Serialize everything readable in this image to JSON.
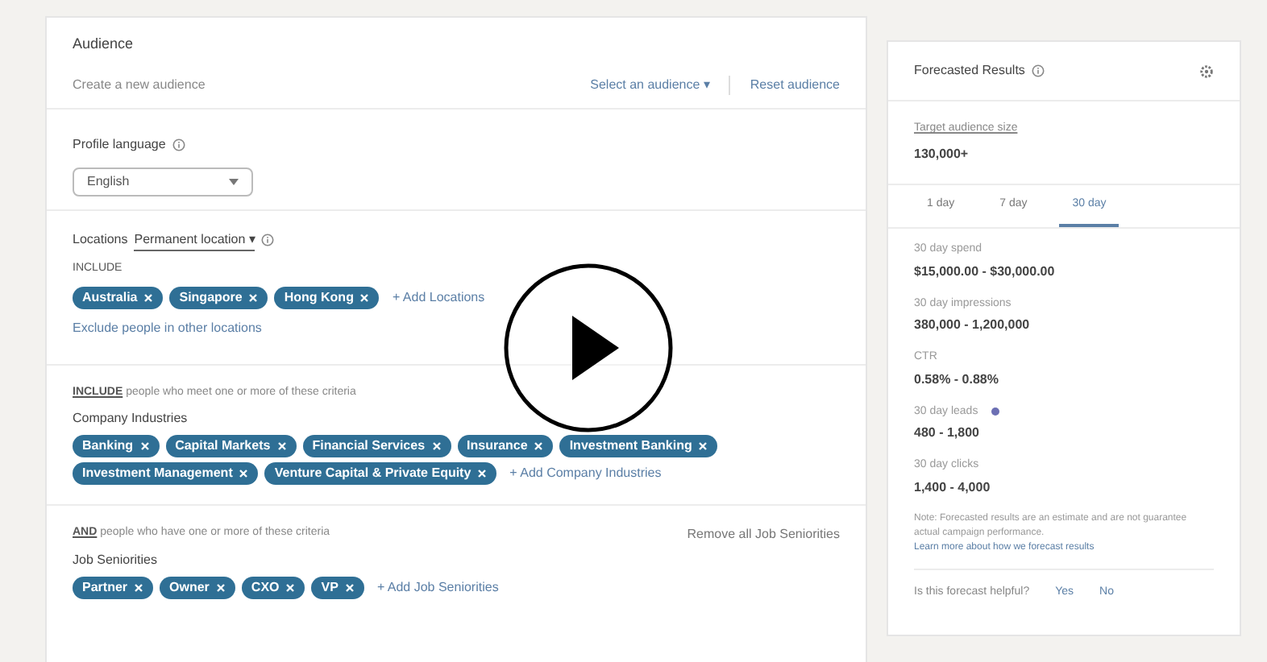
{
  "audience": {
    "title": "Audience",
    "subtitle": "Create a new audience",
    "select_link": "Select an audience ▾",
    "reset_link": "Reset audience"
  },
  "profile_language": {
    "label": "Profile language",
    "value": "English"
  },
  "locations": {
    "label": "Locations",
    "type_select": "Permanent location ▾",
    "include_label": "INCLUDE",
    "chips": [
      "Australia",
      "Singapore",
      "Hong Kong"
    ],
    "add_link": "+ Add Locations",
    "exclude_link": "Exclude people in other locations"
  },
  "criteria": [
    {
      "lead": "INCLUDE",
      "text": "people who meet one or more of these criteria",
      "label": "Company Industries",
      "chips": [
        "Banking",
        "Capital Markets",
        "Financial Services",
        "Insurance",
        "Investment Banking",
        "Investment Management",
        "Venture Capital & Private Equity"
      ],
      "add_link": "+ Add Company Industries"
    },
    {
      "lead": "AND",
      "text": "people who have one or more of these criteria",
      "remove_link": "Remove all Job Seniorities",
      "label": "Job Seniorities",
      "chips": [
        "Partner",
        "Owner",
        "CXO",
        "VP"
      ],
      "add_link": "+ Add Job Seniorities"
    }
  ],
  "forecast": {
    "title": "Forecasted Results",
    "target_label": "Target audience size",
    "target_value": "130,000+",
    "tabs": [
      {
        "label": "1 day",
        "selected": false
      },
      {
        "label": "7 day",
        "selected": false
      },
      {
        "label": "30 day",
        "selected": true
      }
    ],
    "metrics": [
      {
        "label": "30 day spend",
        "value": "$15,000.00 - $30,000.00",
        "flag": false
      },
      {
        "label": "30 day impressions",
        "value": "380,000 - 1,200,000",
        "flag": false
      },
      {
        "label": "CTR",
        "value": "0.58% - 0.88%",
        "flag": false
      },
      {
        "label": "30 day leads",
        "value": "480 - 1,800",
        "flag": true
      },
      {
        "label": "30 day clicks",
        "value": "1,400 - 4,000",
        "flag": false
      }
    ],
    "note": "Note: Forecasted results are an estimate and are not guarantee actual campaign performance.",
    "learn_link": "Learn more about how we forecast results",
    "feedback_question": "Is this forecast helpful?",
    "feedback_buttons": [
      "Yes",
      "No"
    ]
  }
}
